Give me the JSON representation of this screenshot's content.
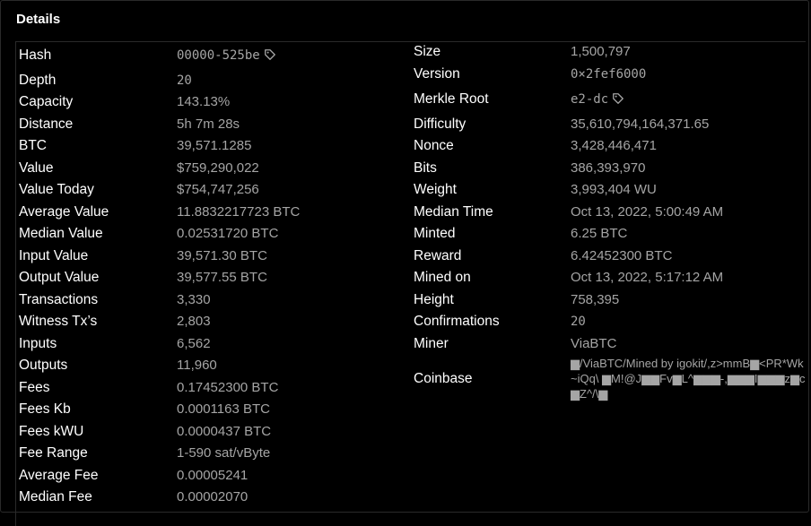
{
  "panel": {
    "title": "Details"
  },
  "left": [
    {
      "label": "Hash",
      "value": "00000-525be",
      "mono": true,
      "icon": "tag-icon"
    },
    {
      "label": "Depth",
      "value": "20",
      "mono": true
    },
    {
      "label": "Capacity",
      "value": "143.13%"
    },
    {
      "label": "Distance",
      "value": "5h 7m 28s"
    },
    {
      "label": "BTC",
      "value": "39,571.1285"
    },
    {
      "label": "Value",
      "value": "$759,290,022"
    },
    {
      "label": "Value Today",
      "value": "$754,747,256"
    },
    {
      "label": "Average Value",
      "value": "11.8832217723 BTC"
    },
    {
      "label": "Median Value",
      "value": "0.02531720 BTC"
    },
    {
      "label": "Input Value",
      "value": "39,571.30 BTC"
    },
    {
      "label": "Output Value",
      "value": "39,577.55 BTC"
    },
    {
      "label": "Transactions",
      "value": "3,330"
    },
    {
      "label": "Witness Tx’s",
      "value": "2,803"
    },
    {
      "label": "Inputs",
      "value": "6,562"
    },
    {
      "label": "Outputs",
      "value": "11,960"
    },
    {
      "label": "Fees",
      "value": "0.17452300 BTC"
    },
    {
      "label": "Fees Kb",
      "value": "0.0001163 BTC"
    },
    {
      "label": "Fees kWU",
      "value": "0.0000437 BTC"
    },
    {
      "label": "Fee Range",
      "value": "1-590 sat/vByte"
    },
    {
      "label": "Average Fee",
      "value": "0.00005241"
    },
    {
      "label": "Median Fee",
      "value": "0.00002070"
    }
  ],
  "right": [
    {
      "label": "Size",
      "value": "1,500,797"
    },
    {
      "label": "Version",
      "value": "0×2fef6000",
      "mono": true
    },
    {
      "label": "Merkle Root",
      "value": "e2-dc",
      "mono": true,
      "icon": "tag-icon"
    },
    {
      "label": "Difficulty",
      "value": "35,610,794,164,371.65"
    },
    {
      "label": "Nonce",
      "value": "3,428,446,471"
    },
    {
      "label": "Bits",
      "value": "386,393,970"
    },
    {
      "label": "Weight",
      "value": "3,993,404 WU"
    },
    {
      "label": "Median Time",
      "value": "Oct 13, 2022, 5:00:49 AM"
    },
    {
      "label": "Minted",
      "value": "6.25 BTC"
    },
    {
      "label": "Reward",
      "value": "6.42452300 BTC"
    },
    {
      "label": "Mined on",
      "value": "Oct 13, 2022, 5:17:12 AM"
    },
    {
      "label": "Height",
      "value": "758,395"
    },
    {
      "label": "Confirmations",
      "value": "20",
      "mono": true
    },
    {
      "label": "Miner",
      "value": "ViaBTC"
    }
  ],
  "coinbase": {
    "label": "Coinbase",
    "value": "▆/ViaBTC/Mined by igokit/,z>mmB▆<PR*Wk~iQq\\ ▆M!@J▆▆Fv▆L^▆▆▆-,▆▆▆I▆▆▆z▆c ▆Z^/\\▆"
  }
}
